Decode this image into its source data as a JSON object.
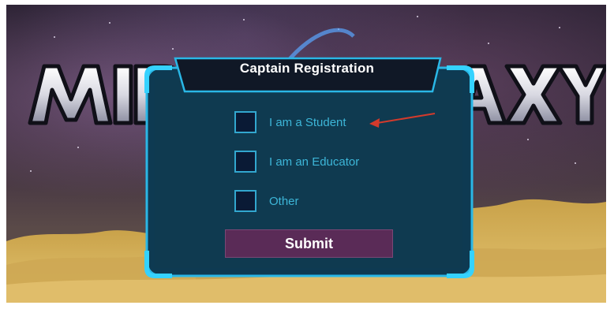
{
  "game_title": "MIDGALAXY",
  "dialog": {
    "title": "Captain Registration",
    "options": [
      {
        "label": "I am a Student",
        "checked": false
      },
      {
        "label": "I am an Educator",
        "checked": false
      },
      {
        "label": "Other",
        "checked": false
      }
    ],
    "submit_label": "Submit"
  },
  "colors": {
    "panel_fill": "#0e3a52",
    "panel_border": "#2ab7e6",
    "header_fill": "#101826",
    "checkbox_border": "#32a7cf",
    "label_text": "#3db6d8",
    "submit_fill": "#5a2b57",
    "annotation_arrow": "#d33a2c"
  },
  "icons": {
    "annotation": "red-arrow-icon"
  }
}
